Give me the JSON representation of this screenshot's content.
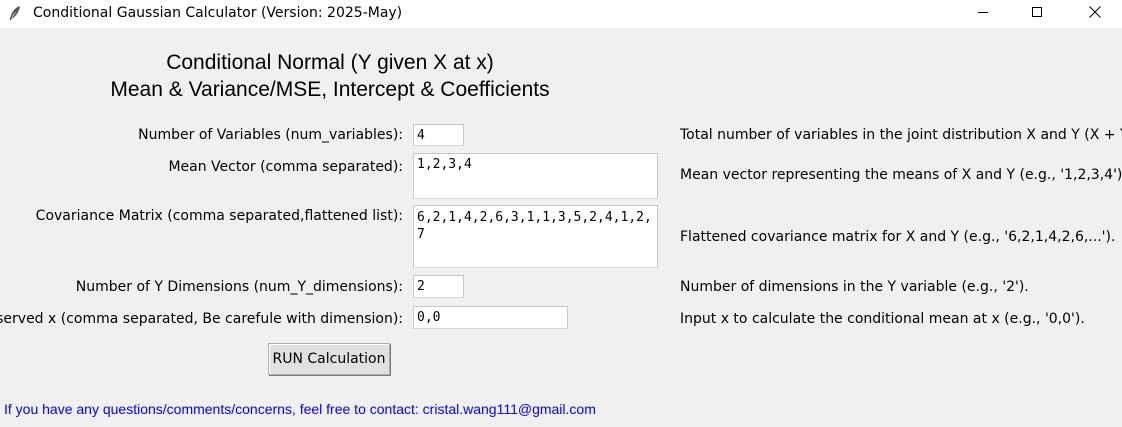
{
  "window": {
    "title": "Conditional Gaussian Calculator (Version: 2025-May)",
    "icons": [
      "feather-icon",
      "minimize-icon",
      "maximize-icon",
      "close-icon"
    ]
  },
  "header": {
    "line1": "Conditional Normal (Y given X at x)",
    "line2": "Mean & Variance/MSE, Intercept & Coefficients"
  },
  "form": {
    "num_variables": {
      "label": "Number of Variables (num_variables):",
      "value": "4",
      "description": "Total number of variables in the joint distribution X and Y (X + Y)."
    },
    "mean_vector": {
      "label": "Mean Vector (comma separated):",
      "value": "1,2,3,4",
      "description": "Mean vector representing the means of X and Y (e.g., '1,2,3,4')."
    },
    "covariance": {
      "label": "Covariance Matrix (comma separated,flattened list):",
      "value": "6,2,1,4,2,6,3,1,1,3,5,2,4,1,2,7",
      "description": "Flattened covariance matrix for X and Y (e.g., '6,2,1,4,2,6,...')."
    },
    "num_y": {
      "label": "Number of Y Dimensions (num_Y_dimensions):",
      "value": "2",
      "description": "Number of dimensions in the Y variable (e.g., '2')."
    },
    "observed_x": {
      "label": "Observed x (comma separated, Be carefule with dimension):",
      "value": "0,0",
      "description": "Input x to calculate the conditional mean at x (e.g., '0,0')."
    }
  },
  "run_button": "RUN Calculation",
  "contact": "If you have any questions/comments/concerns, feel free to contact: cristal.wang111@gmail.com",
  "colors": {
    "background": "#f0f0f0",
    "contact_text": "#0000ff"
  }
}
